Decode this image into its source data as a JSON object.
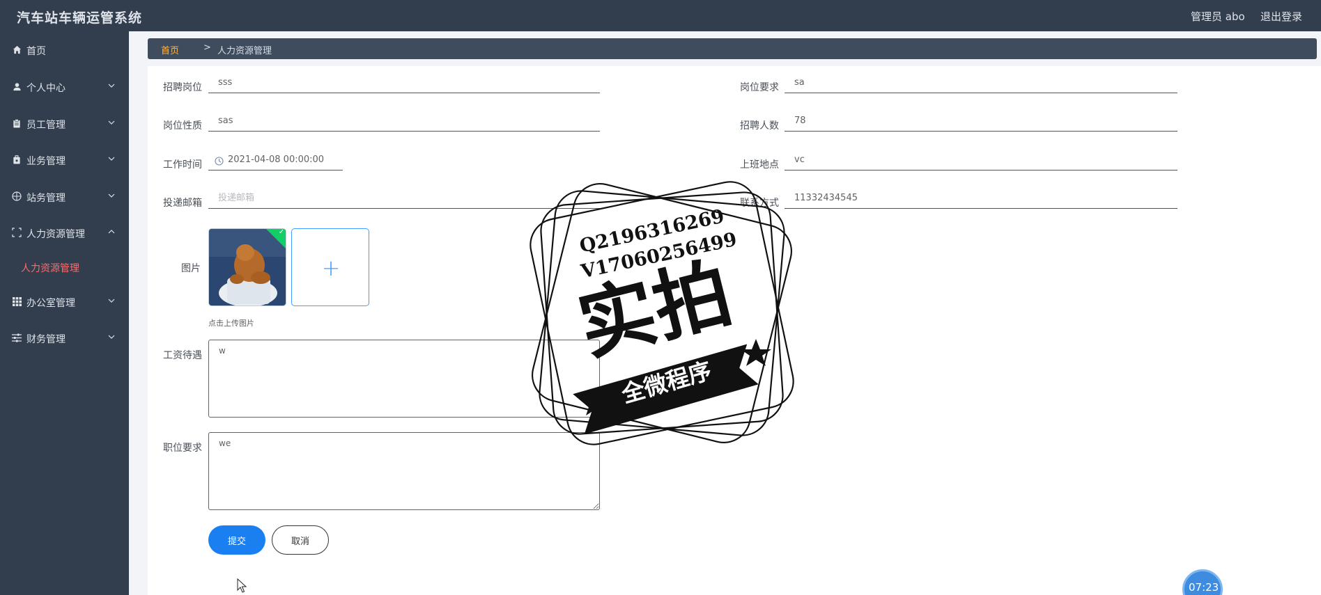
{
  "header": {
    "app_title": "汽车站车辆运管系统",
    "user_label": "管理员 abo",
    "logout_label": "退出登录"
  },
  "sidebar": {
    "items": [
      {
        "label": "首页",
        "icon": "home-icon"
      },
      {
        "label": "个人中心",
        "icon": "user-icon"
      },
      {
        "label": "员工管理",
        "icon": "clipboard-icon"
      },
      {
        "label": "业务管理",
        "icon": "briefcase-icon"
      },
      {
        "label": "站务管理",
        "icon": "compass-icon"
      },
      {
        "label": "人力资源管理",
        "icon": "scan-icon"
      },
      {
        "label": "办公室管理",
        "icon": "grid-icon"
      },
      {
        "label": "财务管理",
        "icon": "sliders-icon"
      }
    ],
    "active_sub_item": "人力资源管理",
    "active_color": "#ff6b6b"
  },
  "breadcrumb": {
    "home": "首页",
    "separator": ">",
    "current": "人力资源管理"
  },
  "form": {
    "position": {
      "label": "招聘岗位",
      "value": "sss"
    },
    "requirement": {
      "label": "岗位要求",
      "value": "sa"
    },
    "nature": {
      "label": "岗位性质",
      "value": "sas"
    },
    "headcount": {
      "label": "招聘人数",
      "value": "78"
    },
    "work_time": {
      "label": "工作时间",
      "value": "2021-04-08 00:00:00"
    },
    "location": {
      "label": "上班地点",
      "value": "vc"
    },
    "email": {
      "label": "投递邮箱",
      "value": "",
      "placeholder": "投递邮箱"
    },
    "contact": {
      "label": "联系方式",
      "value": "11332434545"
    },
    "image": {
      "label": "图片",
      "upload_tip": "点击上传图片",
      "check": "✓",
      "plus": "+"
    },
    "salary": {
      "label": "工资待遇",
      "value": "w"
    },
    "job_requirement": {
      "label": "职位要求",
      "value": "we"
    },
    "submit_label": "提交",
    "cancel_label": "取消"
  },
  "clock": "07:23",
  "watermark": {
    "line1": "Q2196316269",
    "line2": "V17060256499",
    "big": "实拍",
    "banner": "全微程序"
  },
  "colors": {
    "sidebar_bg": "#323d4d",
    "breadcrumb_bg": "#3e4c5e",
    "accent_blue": "#1a7ff0",
    "breadcrumb_home": "#ffb74a"
  }
}
